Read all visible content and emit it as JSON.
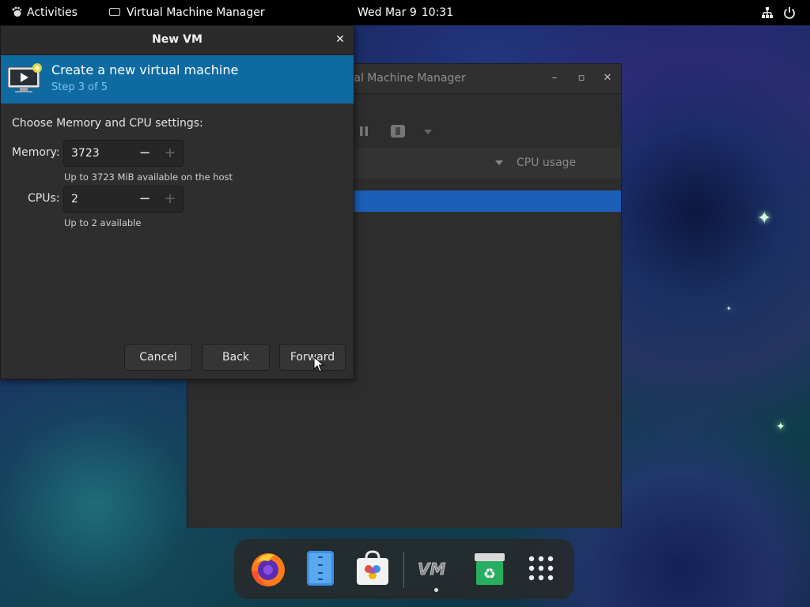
{
  "topbar": {
    "activities": "Activities",
    "app_name": "Virtual Machine Manager",
    "date": "Wed Mar 9",
    "time": "10:31"
  },
  "background_window": {
    "title_fragment": "tual Machine Manager",
    "column_cpu": "CPU usage"
  },
  "dialog": {
    "title": "New VM",
    "banner_title": "Create a new virtual machine",
    "banner_step": "Step 3 of 5",
    "section_label": "Choose Memory and CPU settings:",
    "memory": {
      "label": "Memory:",
      "value": "3723",
      "hint": "Up to 3723 MiB available on the host"
    },
    "cpus": {
      "label": "CPUs:",
      "value": "2",
      "hint": "Up to 2 available"
    },
    "buttons": {
      "cancel": "Cancel",
      "back": "Back",
      "forward": "Forward"
    }
  },
  "dock": {
    "apps": [
      "firefox-icon",
      "text-editor-icon",
      "software-center-icon",
      "virt-manager-icon",
      "recycle-bin-icon",
      "app-grid-icon"
    ]
  },
  "colors": {
    "banner": "#0f6aa1",
    "selection": "#1c5fb8",
    "topbar": "#000000"
  }
}
